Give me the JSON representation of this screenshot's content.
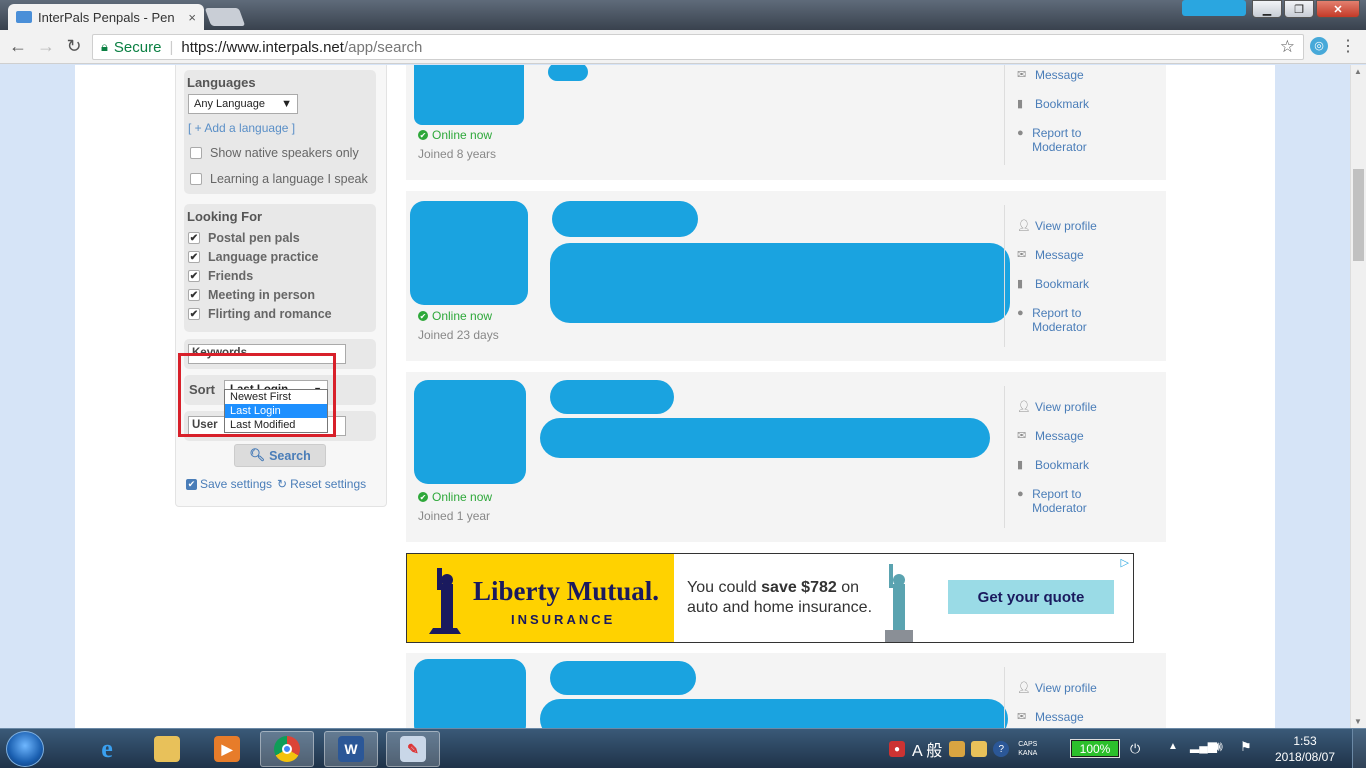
{
  "browser": {
    "tab_title": "InterPals Penpals - Pen",
    "tab_close": "×",
    "url_secure": "Secure",
    "url_host": "https://www.interpals.net",
    "url_path": "/app/search",
    "back": "←",
    "forward": "→",
    "reload": "↻",
    "star": "☆",
    "menu": "⋮",
    "win_minimize": "▁",
    "win_maximize": "❐",
    "win_close": "✕"
  },
  "sidebar": {
    "languages": {
      "heading": "Languages",
      "select_value": "Any Language",
      "add_link": "[ + Add a language ]",
      "native_only": "Show native speakers only",
      "learning": "Learning a language I speak"
    },
    "looking_for": {
      "heading": "Looking For",
      "items": [
        {
          "label": "Postal pen pals",
          "checked": true
        },
        {
          "label": "Language practice",
          "checked": true
        },
        {
          "label": "Friends",
          "checked": true
        },
        {
          "label": "Meeting in person",
          "checked": true
        },
        {
          "label": "Flirting and romance",
          "checked": true
        }
      ]
    },
    "keywords_placeholder": "Keywords",
    "sort": {
      "label": "Sort",
      "selected": "Last Login",
      "options": [
        "Newest First",
        "Last Login",
        "Last Modified"
      ]
    },
    "username_partial": "User",
    "search_button": "Search",
    "save_settings": "Save settings",
    "reset_settings": "Reset settings"
  },
  "results": [
    {
      "status": "Online now",
      "joined": "Joined 8 years",
      "actions": [
        "Message",
        "Bookmark",
        "Report to Moderator"
      ]
    },
    {
      "status": "Online now",
      "joined": "Joined 23 days",
      "actions": [
        "View profile",
        "Message",
        "Bookmark",
        "Report to Moderator"
      ]
    },
    {
      "status": "Online now",
      "joined": "Joined 1 year",
      "actions": [
        "View profile",
        "Message",
        "Bookmark",
        "Report to Moderator"
      ]
    },
    {
      "status": "",
      "joined": "",
      "actions": [
        "View profile",
        "Message"
      ]
    }
  ],
  "ad": {
    "brand": "Liberty Mutual.",
    "brand_sub": "INSURANCE",
    "copy_line1_a": "You could ",
    "copy_line1_b": "save $782",
    "copy_line1_c": " on",
    "copy_line2": "auto and home insurance.",
    "cta": "Get your quote",
    "adchoices": "▷"
  },
  "taskbar": {
    "ime": "A 般",
    "caps": "CAPS",
    "kana": "KANA",
    "battery": "100%",
    "battery_level": 1.0,
    "time": "1:53",
    "date": "2018/08/07"
  },
  "colors": {
    "accent_link": "#4a7db8",
    "online": "#2ea83a",
    "redaction": "#1aa3e0",
    "highlight": "#d8202a"
  }
}
